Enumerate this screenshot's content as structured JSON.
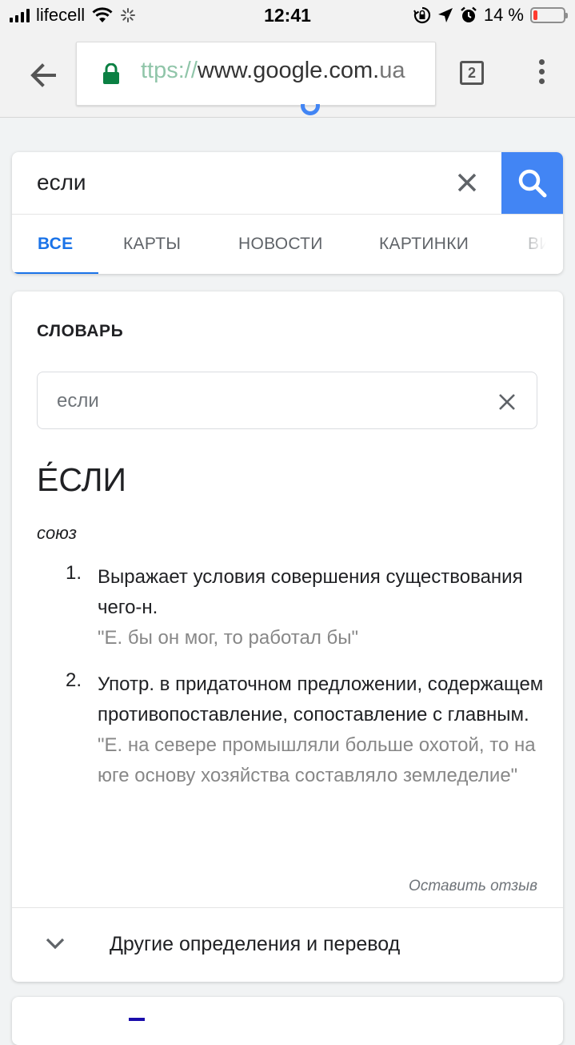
{
  "status_bar": {
    "carrier": "lifecell",
    "time": "12:41",
    "battery_percent": "14 %",
    "battery_level": 0.14,
    "icons": [
      "signal-icon",
      "wifi-icon",
      "loading-icon",
      "orientation-lock-icon",
      "location-icon",
      "alarm-icon",
      "battery-icon"
    ]
  },
  "browser": {
    "url_scheme": "ttps://",
    "url_host": "www.google.com.",
    "url_host_tail": "ua",
    "tab_count": "2"
  },
  "search": {
    "query": "если",
    "tabs": [
      "ВСЕ",
      "КАРТЫ",
      "НОВОСТИ",
      "КАРТИНКИ",
      "ВИ"
    ],
    "active_tab_index": 0
  },
  "dictionary": {
    "title": "СЛОВАРЬ",
    "input_value": "если",
    "headword": "Е́СЛИ",
    "part_of_speech": "союз",
    "definitions": [
      {
        "number": "1.",
        "text": "Выражает условия совершения существования чего-н.",
        "example": "\"Е. бы он мог, то работал бы\""
      },
      {
        "number": "2.",
        "text": "Употр. в придаточном предложении, содержащем противопоставление, сопоставление с главным.",
        "example": "\"Е. на севере промышляли больше охотой, то на юге основу хозяйства составляло земледелие\""
      }
    ],
    "feedback_label": "Оставить отзыв",
    "more_label": "Другие определения и перевод"
  },
  "colors": {
    "accent_blue": "#4285f4",
    "tab_active": "#1a73e8",
    "lock_green": "#0b8043",
    "battery_low": "#ff3b30"
  }
}
